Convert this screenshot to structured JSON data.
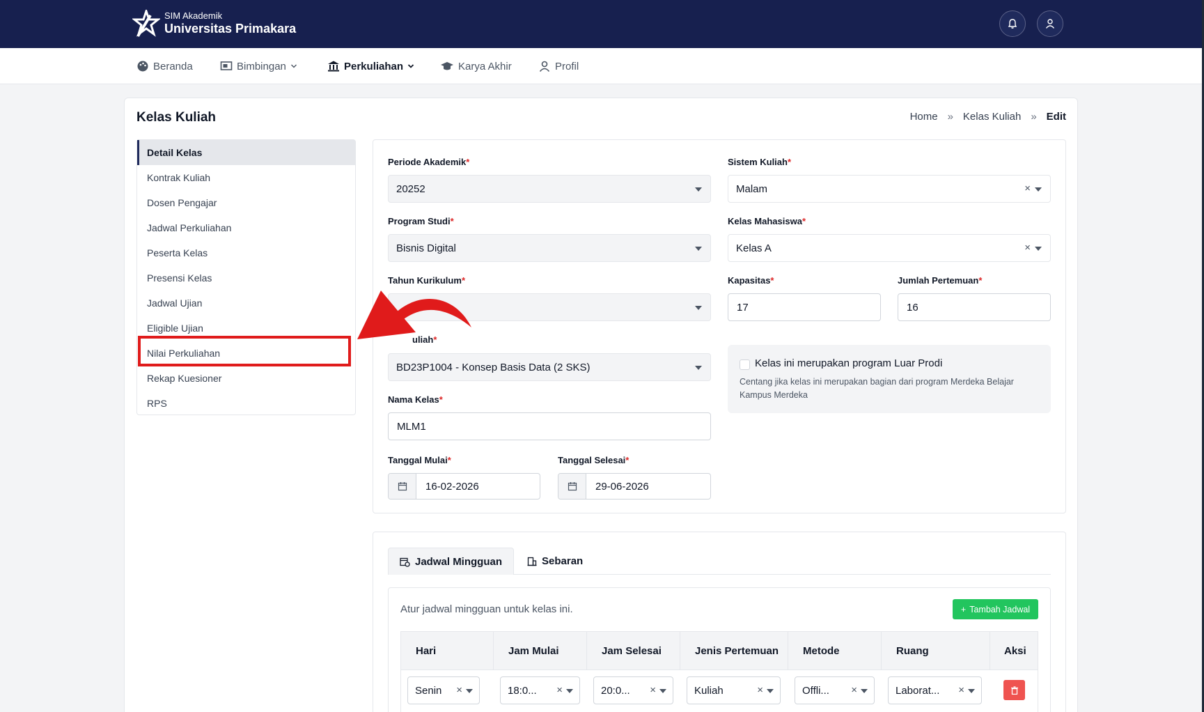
{
  "header": {
    "brand_sub": "SIM Akademik",
    "brand_main": "Universitas Primakara"
  },
  "nav": [
    {
      "label": "Beranda",
      "icon": "palette-icon"
    },
    {
      "label": "Bimbingan",
      "icon": "presentation-icon"
    },
    {
      "label": "Perkuliahan",
      "icon": "institution-icon"
    },
    {
      "label": "Karya Akhir",
      "icon": "graduation-cap-icon"
    },
    {
      "label": "Profil",
      "icon": "user-icon"
    }
  ],
  "page": {
    "title": "Kelas Kuliah",
    "breadcrumb": {
      "home": "Home",
      "section": "Kelas Kuliah",
      "current": "Edit",
      "sep": "»"
    }
  },
  "side_menu": [
    {
      "label": "Detail Kelas",
      "active": true
    },
    {
      "label": "Kontrak Kuliah"
    },
    {
      "label": "Dosen Pengajar"
    },
    {
      "label": "Jadwal Perkuliahan"
    },
    {
      "label": "Peserta Kelas"
    },
    {
      "label": "Presensi Kelas"
    },
    {
      "label": "Jadwal Ujian"
    },
    {
      "label": "Eligible Ujian"
    },
    {
      "label": "Nilai Perkuliahan",
      "highlighted": true
    },
    {
      "label": "Rekap Kuesioner"
    },
    {
      "label": "RPS"
    }
  ],
  "form": {
    "periode": {
      "label": "Periode Akademik",
      "value": "20252"
    },
    "sistem": {
      "label": "Sistem Kuliah",
      "value": "Malam"
    },
    "prodi": {
      "label": "Program Studi",
      "value": "Bisnis Digital"
    },
    "kelas_mhs": {
      "label": "Kelas Mahasiswa",
      "value": "Kelas A"
    },
    "kurikulum": {
      "label": "Tahun Kurikulum",
      "value": ""
    },
    "kapasitas": {
      "label": "Kapasitas",
      "value": "17"
    },
    "pertemuan": {
      "label": "Jumlah Pertemuan",
      "value": "16"
    },
    "matkul": {
      "label_visible": "uliah",
      "value": "BD23P1004 - Konsep Basis Data (2 SKS)"
    },
    "nama_kelas": {
      "label": "Nama Kelas",
      "value": "MLM1"
    },
    "tgl_mulai": {
      "label": "Tanggal Mulai",
      "value": "16-02-2026"
    },
    "tgl_selesai": {
      "label": "Tanggal Selesai",
      "value": "29-06-2026"
    },
    "luar_prodi": {
      "title": "Kelas ini merupakan program Luar Prodi",
      "desc": "Centang jika kelas ini merupakan bagian dari program Merdeka Belajar Kampus Merdeka",
      "checked": false
    },
    "required_mark": "*"
  },
  "schedule": {
    "tabs": [
      {
        "label": "Jadwal Mingguan",
        "icon": "calendar-clock-icon",
        "active": true
      },
      {
        "label": "Sebaran",
        "icon": "building-icon"
      }
    ],
    "description": "Atur jadwal mingguan untuk kelas ini.",
    "add_label": "Tambah Jadwal",
    "columns": [
      "Hari",
      "Jam Mulai",
      "Jam Selesai",
      "Jenis Pertemuan",
      "Metode",
      "Ruang",
      "Aksi"
    ],
    "rows": [
      {
        "hari": "Senin",
        "jam_mulai": "18:0...",
        "jam_selesai": "20:0...",
        "jenis": "Kuliah",
        "metode": "Offli...",
        "ruang": "Laborat..."
      }
    ]
  },
  "colors": {
    "topbar": "#17204f",
    "accent_red": "#e01b1b",
    "add_green": "#22c55e",
    "delete_red": "#ef5350"
  },
  "symbols": {
    "clear": "×",
    "plus": "+"
  }
}
